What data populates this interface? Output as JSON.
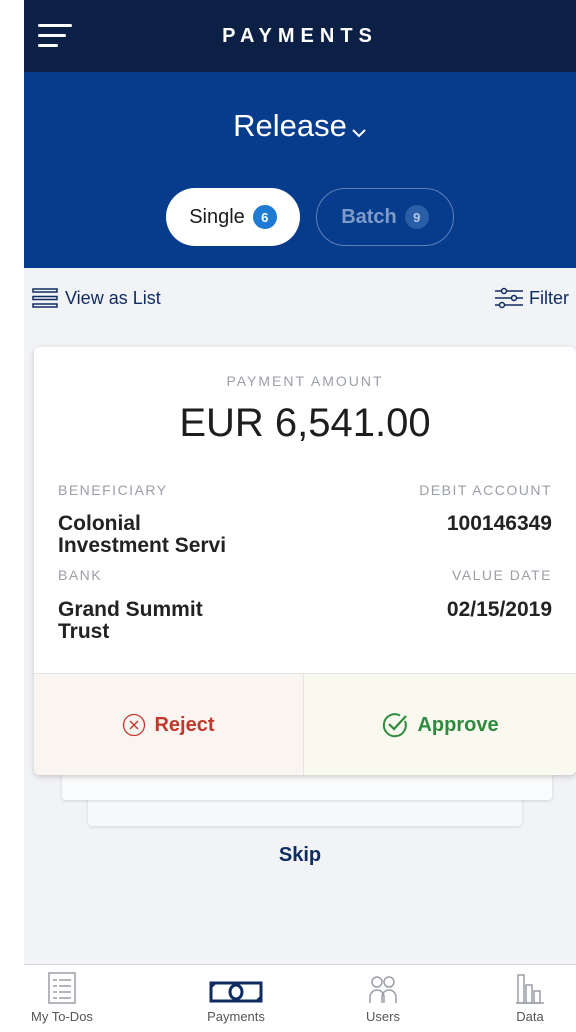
{
  "header": {
    "app_title": "PAYMENTS",
    "section_title": "Release",
    "tabs": [
      {
        "label": "Single",
        "count": "6"
      },
      {
        "label": "Batch",
        "count": "9"
      }
    ]
  },
  "toolbar": {
    "view_as_list": "View as List",
    "filter": "Filter"
  },
  "card": {
    "amount_label": "PAYMENT AMOUNT",
    "amount": "EUR 6,541.00",
    "beneficiary_label": "BENEFICIARY",
    "beneficiary_line1": "Colonial",
    "beneficiary_line2": "Investment Servi",
    "debit_account_label": "DEBIT ACCOUNT",
    "debit_account": "100146349",
    "bank_label": "BANK",
    "bank_line1": "Grand Summit",
    "bank_line2": "Trust",
    "value_date_label": "VALUE DATE",
    "value_date": "02/15/2019",
    "reject_label": "Reject",
    "approve_label": "Approve"
  },
  "skip_label": "Skip",
  "bottom_nav": [
    {
      "label": "My To-Dos",
      "icon": "checklist-icon"
    },
    {
      "label": "Payments",
      "icon": "money-icon"
    },
    {
      "label": "Users",
      "icon": "users-icon"
    },
    {
      "label": "Data",
      "icon": "bar-chart-icon"
    }
  ],
  "colors": {
    "top_bar": "#0c1f45",
    "header": "#073b8c",
    "reject": "#c0392b",
    "approve": "#2e8b3e",
    "link": "#0f2c61"
  }
}
